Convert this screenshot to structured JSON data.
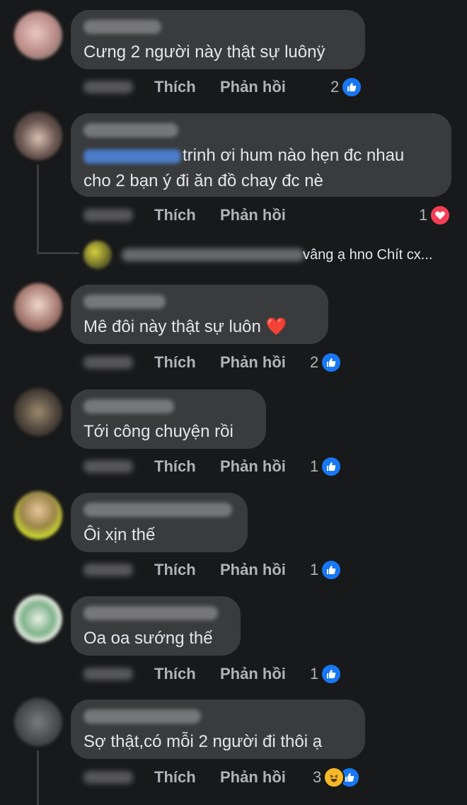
{
  "labels": {
    "like": "Thích",
    "reply": "Phản hồi"
  },
  "icons": {
    "like": "thumbs-up-icon",
    "love": "heart-icon",
    "haha": "laughing-emoji-icon"
  },
  "colors": {
    "background": "#18191a",
    "bubble": "#3a3b3c",
    "like_blue": "#1877f2",
    "love_red": "#f33e58"
  },
  "comments": [
    {
      "lines": [
        "Cưng 2 người này thật sự luônÿ"
      ],
      "reaction_count": "2"
    },
    {
      "lines": [
        "trinh ơi hum nào hẹn đc nhau",
        "cho 2 bạn ý đi ăn đồ chay đc nè"
      ],
      "reaction_count": "1"
    },
    {
      "lines": [
        "Mê đôi này thật sự luôn ❤️"
      ],
      "reaction_count": "2"
    },
    {
      "lines": [
        "Tới công chuyện rồi"
      ],
      "reaction_count": "1"
    },
    {
      "lines": [
        "Ôi xịn thế"
      ],
      "reaction_count": "1"
    },
    {
      "lines": [
        "Oa oa sướng thế"
      ],
      "reaction_count": "1"
    },
    {
      "lines": [
        "Sợ thật,có mỗi 2 người đi thôi ạ"
      ],
      "reaction_count": "3"
    }
  ],
  "reply_preview": {
    "text": "vâng ạ hno Chít cx..."
  }
}
